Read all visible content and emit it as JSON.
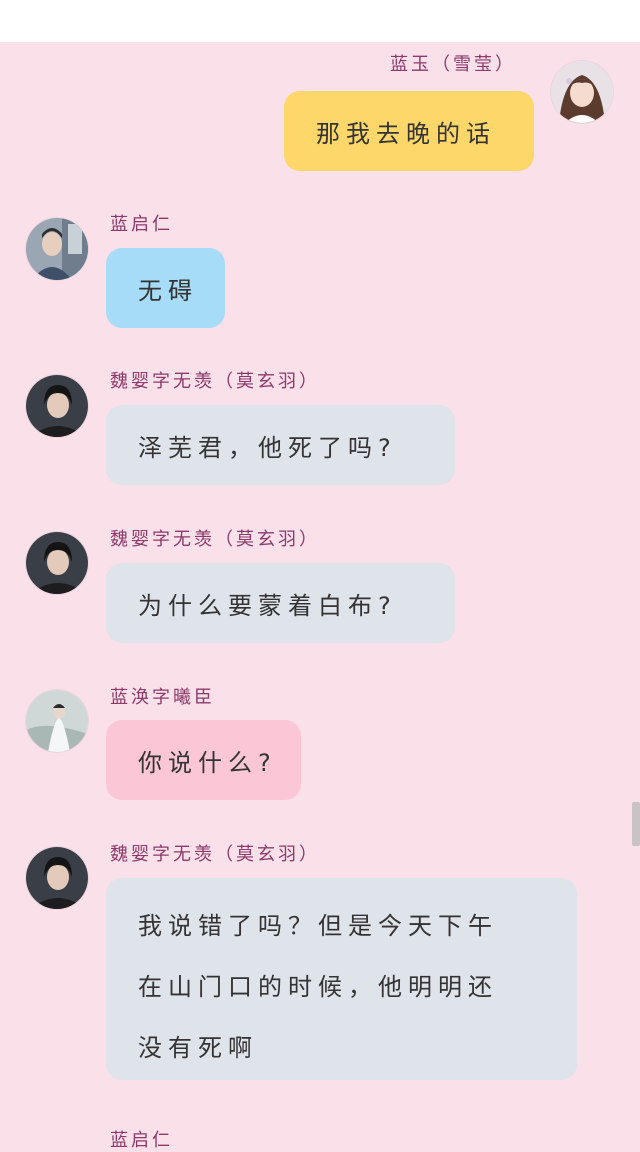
{
  "colors": {
    "background": "#f9e0e9",
    "name_text": "#8b3a6a",
    "bubble_yellow": "#fdd76a",
    "bubble_blue": "#a6dcf7",
    "bubble_gray": "#dfe3ea",
    "bubble_pink": "#fbc7d6"
  },
  "messages": [
    {
      "sender": "蓝玉（雪莹）",
      "text": "那我去晚的话",
      "side": "right",
      "bubble_color": "yellow"
    },
    {
      "sender": "蓝启仁",
      "text": "无碍",
      "side": "left",
      "bubble_color": "blue"
    },
    {
      "sender": "魏婴字无羡（莫玄羽）",
      "text": "泽芜君，他死了吗?",
      "side": "left",
      "bubble_color": "gray"
    },
    {
      "sender": "魏婴字无羡（莫玄羽）",
      "text": "为什么要蒙着白布?",
      "side": "left",
      "bubble_color": "gray"
    },
    {
      "sender": "蓝涣字曦臣",
      "text": "你说什么?",
      "side": "left",
      "bubble_color": "pink"
    },
    {
      "sender": "魏婴字无羡（莫玄羽）",
      "lines": [
        "我说错了吗？但是今天下午",
        "在山门口的时候，他明明还",
        "没有死啊"
      ],
      "side": "left",
      "bubble_color": "gray"
    },
    {
      "sender": "蓝启仁",
      "side": "left",
      "partial": true
    }
  ]
}
